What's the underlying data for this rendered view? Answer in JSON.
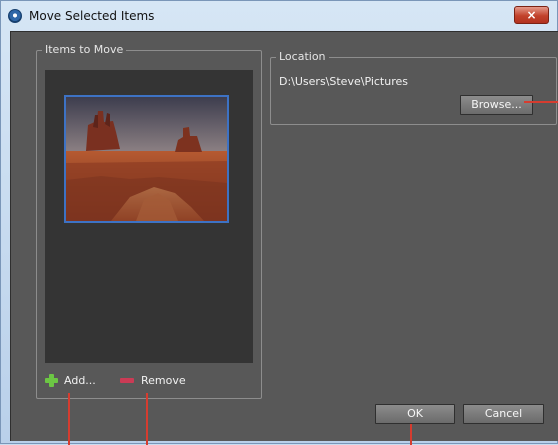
{
  "window": {
    "title": "Move Selected Items",
    "close_label": "×"
  },
  "items_panel": {
    "title": "Items to Move",
    "add_label": "Add...",
    "remove_label": "Remove"
  },
  "location_panel": {
    "title": "Location",
    "path": "D:\\Users\\Steve\\Pictures",
    "browse_label": "Browse..."
  },
  "dialog": {
    "ok_label": "OK",
    "cancel_label": "Cancel"
  },
  "colors": {
    "titlebar": "#c9dcef",
    "client_bg": "#585858",
    "selection_border": "#3d72c4",
    "callout": "#d63c2f",
    "add_icon": "#6cc644",
    "remove_icon": "#cb3b55"
  }
}
